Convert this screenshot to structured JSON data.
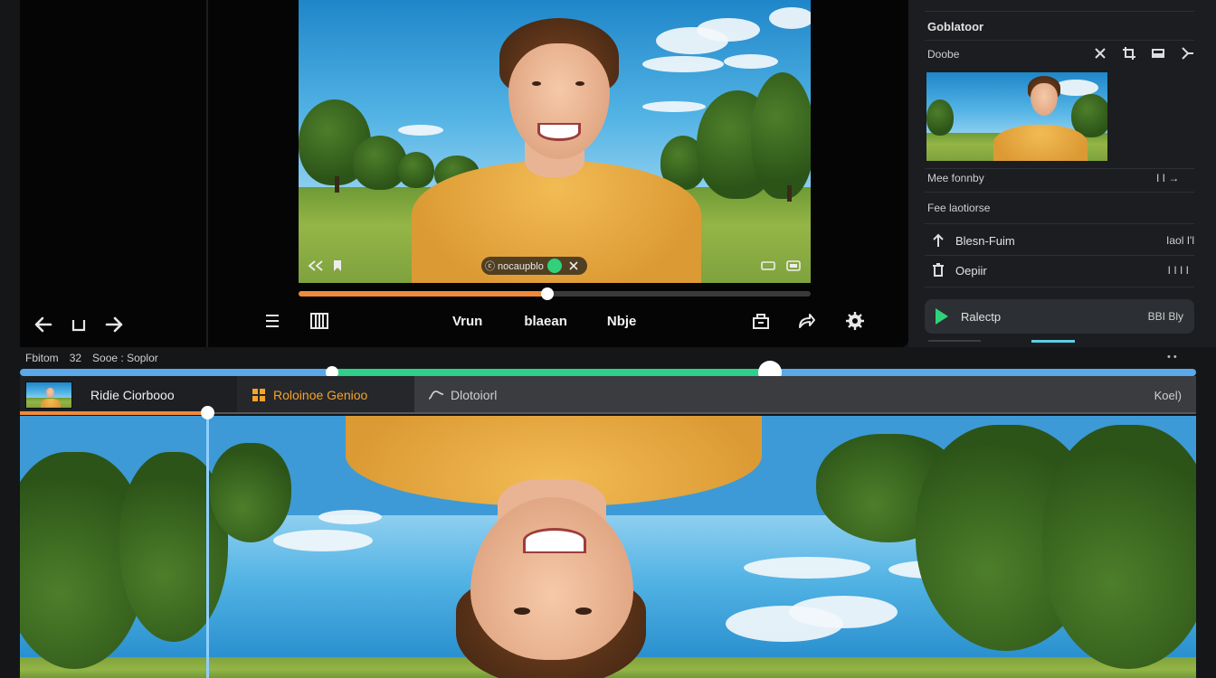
{
  "viewer": {
    "toolbar": {
      "label_1": "Vrun",
      "label_2": "blaean",
      "label_3": "Nbje"
    },
    "overlay": {
      "caption_text": "ⓒ nocaupblo",
      "progress_fraction": 0.485
    }
  },
  "right_panel": {
    "title": "Goblatoor",
    "row_label": "Doobe",
    "section_1": "Mee fonnby",
    "section_1_value": "I I →",
    "section_2": "Fee laotiorse",
    "item_1_label": "Blesn-Fuim",
    "item_1_value": "Iaol I'l",
    "item_2_label": "Oepiir",
    "item_2_value": "I I I I",
    "render_label": "Ralectp",
    "render_value": "BBI Bly"
  },
  "timeline": {
    "meta_1": "Fbitom",
    "meta_2": "32",
    "meta_3": "Sooe : Soplor",
    "corner_value": "• •",
    "clip_name": "Ridie Ciorbooo",
    "segment_2_label": "Roloinoe Genioo",
    "segment_3_label": "Dlotoiorl",
    "segment_3_value": "Koel)",
    "selection_start": 0.265,
    "selection_end": 0.638
  },
  "colors": {
    "accent_green": "#2fd27a",
    "accent_orange": "#f08a3a",
    "accent_blue": "#5aa8ea",
    "panel_bg": "#1b1d20"
  },
  "icons": {
    "left_controls": [
      "arrow-left-icon",
      "square-bracket-icon",
      "arrow-right-icon"
    ],
    "viewer_toolbar": [
      "list-icon",
      "film-icon",
      "export-box-icon",
      "share-arrow-icon",
      "gear-icon"
    ],
    "right_panel_header": [
      "close-x-icon",
      "crop-icon",
      "image-icon",
      "expand-icon"
    ]
  }
}
